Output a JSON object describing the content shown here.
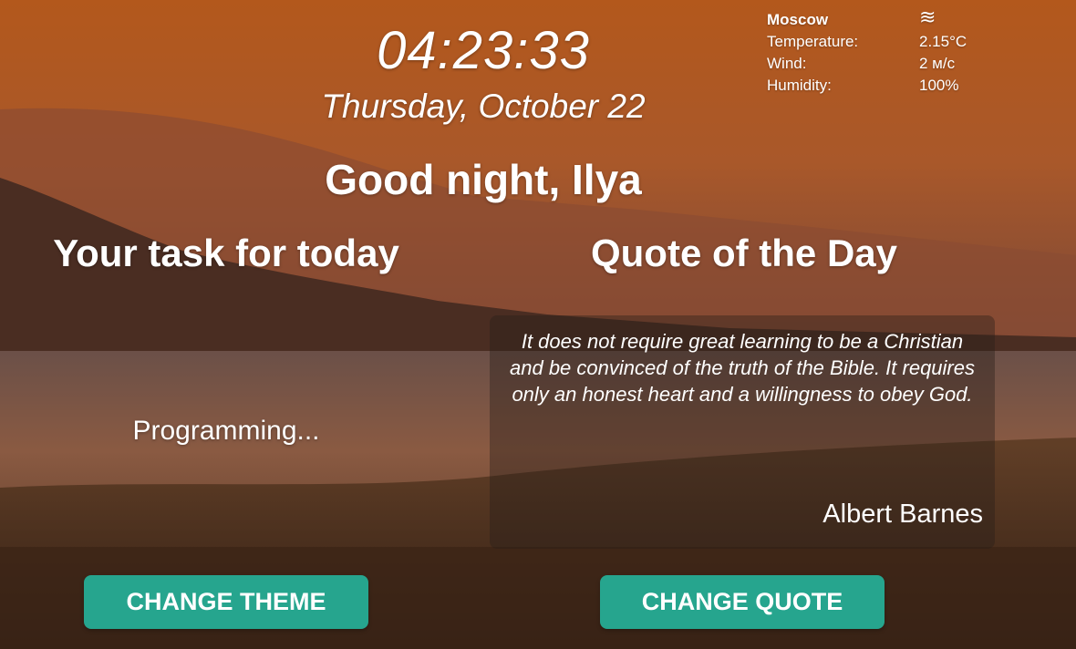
{
  "clock": {
    "time": "04:23:33",
    "date": "Thursday, October 22"
  },
  "greeting": "Good night, Ilya",
  "weather": {
    "city": "Moscow",
    "icon": "mist-icon",
    "icon_glyph": "≋",
    "rows": [
      {
        "label": "Temperature:",
        "value": "2.15°C"
      },
      {
        "label": "Wind:",
        "value": "2 м/с"
      },
      {
        "label": "Humidity:",
        "value": "100%"
      }
    ]
  },
  "task": {
    "title": "Your task for today",
    "text": "Programming..."
  },
  "quote": {
    "title": "Quote of the Day",
    "text": "It does not require great learning to be a Christian and be convinced of the truth of the Bible. It requires only an honest heart and a willingness to obey God.",
    "author": "Albert Barnes"
  },
  "buttons": {
    "change_theme": "CHANGE THEME",
    "change_quote": "CHANGE QUOTE"
  },
  "colors": {
    "button_bg": "#26a58e",
    "sky_top": "#b3581c",
    "water": "#6a4a3c",
    "text": "#ffffff"
  }
}
